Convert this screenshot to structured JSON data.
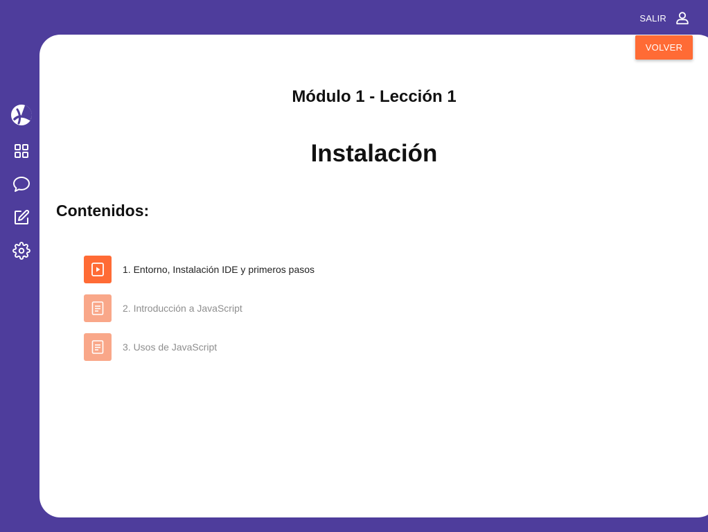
{
  "header": {
    "logout_label": "SALIR",
    "user_icon": "user-icon"
  },
  "sidebar": {
    "items": [
      {
        "name": "logo",
        "icon": "logo-icon"
      },
      {
        "name": "dashboard",
        "icon": "grid-icon"
      },
      {
        "name": "chat",
        "icon": "chat-bubble-icon"
      },
      {
        "name": "edit",
        "icon": "edit-icon"
      },
      {
        "name": "settings",
        "icon": "gear-icon"
      }
    ]
  },
  "main": {
    "back_label": "VOLVER",
    "module_title": "Módulo 1 - Lección 1",
    "lesson_title": "Instalación",
    "contents_heading": "Contenidos:",
    "contents": [
      {
        "label": "1. Entorno, Instalación IDE y primeros pasos",
        "icon": "video-icon",
        "state": "active"
      },
      {
        "label": "2. Introducción a JavaScript",
        "icon": "document-icon",
        "state": "inactive"
      },
      {
        "label": "3. Usos de JavaScript",
        "icon": "document-icon",
        "state": "inactive"
      }
    ]
  },
  "colors": {
    "background": "#4e3d9c",
    "accent": "#ff6b35",
    "accent_faded": "#f9a789",
    "card": "#ffffff"
  }
}
